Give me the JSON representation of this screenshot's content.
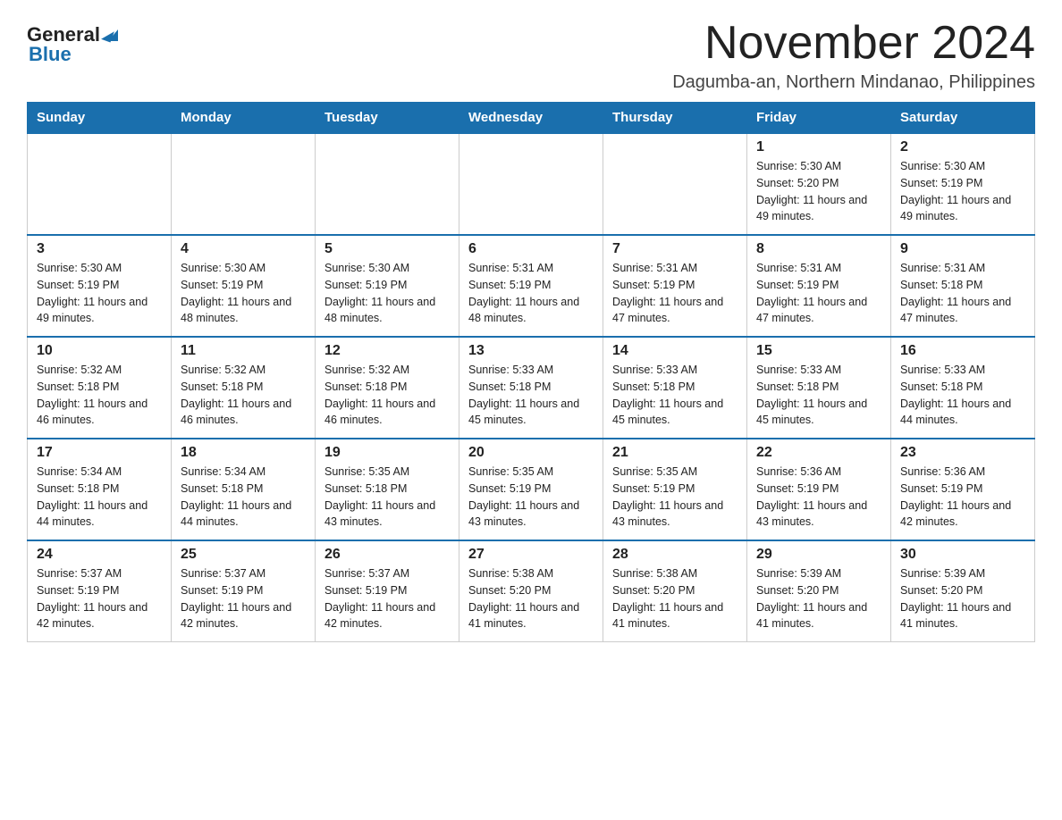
{
  "logo": {
    "general": "General",
    "blue": "Blue"
  },
  "title": {
    "month": "November 2024",
    "location": "Dagumba-an, Northern Mindanao, Philippines"
  },
  "days_of_week": [
    "Sunday",
    "Monday",
    "Tuesday",
    "Wednesday",
    "Thursday",
    "Friday",
    "Saturday"
  ],
  "weeks": [
    [
      {
        "day": "",
        "sunrise": "",
        "sunset": "",
        "daylight": ""
      },
      {
        "day": "",
        "sunrise": "",
        "sunset": "",
        "daylight": ""
      },
      {
        "day": "",
        "sunrise": "",
        "sunset": "",
        "daylight": ""
      },
      {
        "day": "",
        "sunrise": "",
        "sunset": "",
        "daylight": ""
      },
      {
        "day": "",
        "sunrise": "",
        "sunset": "",
        "daylight": ""
      },
      {
        "day": "1",
        "sunrise": "Sunrise: 5:30 AM",
        "sunset": "Sunset: 5:20 PM",
        "daylight": "Daylight: 11 hours and 49 minutes."
      },
      {
        "day": "2",
        "sunrise": "Sunrise: 5:30 AM",
        "sunset": "Sunset: 5:19 PM",
        "daylight": "Daylight: 11 hours and 49 minutes."
      }
    ],
    [
      {
        "day": "3",
        "sunrise": "Sunrise: 5:30 AM",
        "sunset": "Sunset: 5:19 PM",
        "daylight": "Daylight: 11 hours and 49 minutes."
      },
      {
        "day": "4",
        "sunrise": "Sunrise: 5:30 AM",
        "sunset": "Sunset: 5:19 PM",
        "daylight": "Daylight: 11 hours and 48 minutes."
      },
      {
        "day": "5",
        "sunrise": "Sunrise: 5:30 AM",
        "sunset": "Sunset: 5:19 PM",
        "daylight": "Daylight: 11 hours and 48 minutes."
      },
      {
        "day": "6",
        "sunrise": "Sunrise: 5:31 AM",
        "sunset": "Sunset: 5:19 PM",
        "daylight": "Daylight: 11 hours and 48 minutes."
      },
      {
        "day": "7",
        "sunrise": "Sunrise: 5:31 AM",
        "sunset": "Sunset: 5:19 PM",
        "daylight": "Daylight: 11 hours and 47 minutes."
      },
      {
        "day": "8",
        "sunrise": "Sunrise: 5:31 AM",
        "sunset": "Sunset: 5:19 PM",
        "daylight": "Daylight: 11 hours and 47 minutes."
      },
      {
        "day": "9",
        "sunrise": "Sunrise: 5:31 AM",
        "sunset": "Sunset: 5:18 PM",
        "daylight": "Daylight: 11 hours and 47 minutes."
      }
    ],
    [
      {
        "day": "10",
        "sunrise": "Sunrise: 5:32 AM",
        "sunset": "Sunset: 5:18 PM",
        "daylight": "Daylight: 11 hours and 46 minutes."
      },
      {
        "day": "11",
        "sunrise": "Sunrise: 5:32 AM",
        "sunset": "Sunset: 5:18 PM",
        "daylight": "Daylight: 11 hours and 46 minutes."
      },
      {
        "day": "12",
        "sunrise": "Sunrise: 5:32 AM",
        "sunset": "Sunset: 5:18 PM",
        "daylight": "Daylight: 11 hours and 46 minutes."
      },
      {
        "day": "13",
        "sunrise": "Sunrise: 5:33 AM",
        "sunset": "Sunset: 5:18 PM",
        "daylight": "Daylight: 11 hours and 45 minutes."
      },
      {
        "day": "14",
        "sunrise": "Sunrise: 5:33 AM",
        "sunset": "Sunset: 5:18 PM",
        "daylight": "Daylight: 11 hours and 45 minutes."
      },
      {
        "day": "15",
        "sunrise": "Sunrise: 5:33 AM",
        "sunset": "Sunset: 5:18 PM",
        "daylight": "Daylight: 11 hours and 45 minutes."
      },
      {
        "day": "16",
        "sunrise": "Sunrise: 5:33 AM",
        "sunset": "Sunset: 5:18 PM",
        "daylight": "Daylight: 11 hours and 44 minutes."
      }
    ],
    [
      {
        "day": "17",
        "sunrise": "Sunrise: 5:34 AM",
        "sunset": "Sunset: 5:18 PM",
        "daylight": "Daylight: 11 hours and 44 minutes."
      },
      {
        "day": "18",
        "sunrise": "Sunrise: 5:34 AM",
        "sunset": "Sunset: 5:18 PM",
        "daylight": "Daylight: 11 hours and 44 minutes."
      },
      {
        "day": "19",
        "sunrise": "Sunrise: 5:35 AM",
        "sunset": "Sunset: 5:18 PM",
        "daylight": "Daylight: 11 hours and 43 minutes."
      },
      {
        "day": "20",
        "sunrise": "Sunrise: 5:35 AM",
        "sunset": "Sunset: 5:19 PM",
        "daylight": "Daylight: 11 hours and 43 minutes."
      },
      {
        "day": "21",
        "sunrise": "Sunrise: 5:35 AM",
        "sunset": "Sunset: 5:19 PM",
        "daylight": "Daylight: 11 hours and 43 minutes."
      },
      {
        "day": "22",
        "sunrise": "Sunrise: 5:36 AM",
        "sunset": "Sunset: 5:19 PM",
        "daylight": "Daylight: 11 hours and 43 minutes."
      },
      {
        "day": "23",
        "sunrise": "Sunrise: 5:36 AM",
        "sunset": "Sunset: 5:19 PM",
        "daylight": "Daylight: 11 hours and 42 minutes."
      }
    ],
    [
      {
        "day": "24",
        "sunrise": "Sunrise: 5:37 AM",
        "sunset": "Sunset: 5:19 PM",
        "daylight": "Daylight: 11 hours and 42 minutes."
      },
      {
        "day": "25",
        "sunrise": "Sunrise: 5:37 AM",
        "sunset": "Sunset: 5:19 PM",
        "daylight": "Daylight: 11 hours and 42 minutes."
      },
      {
        "day": "26",
        "sunrise": "Sunrise: 5:37 AM",
        "sunset": "Sunset: 5:19 PM",
        "daylight": "Daylight: 11 hours and 42 minutes."
      },
      {
        "day": "27",
        "sunrise": "Sunrise: 5:38 AM",
        "sunset": "Sunset: 5:20 PM",
        "daylight": "Daylight: 11 hours and 41 minutes."
      },
      {
        "day": "28",
        "sunrise": "Sunrise: 5:38 AM",
        "sunset": "Sunset: 5:20 PM",
        "daylight": "Daylight: 11 hours and 41 minutes."
      },
      {
        "day": "29",
        "sunrise": "Sunrise: 5:39 AM",
        "sunset": "Sunset: 5:20 PM",
        "daylight": "Daylight: 11 hours and 41 minutes."
      },
      {
        "day": "30",
        "sunrise": "Sunrise: 5:39 AM",
        "sunset": "Sunset: 5:20 PM",
        "daylight": "Daylight: 11 hours and 41 minutes."
      }
    ]
  ]
}
